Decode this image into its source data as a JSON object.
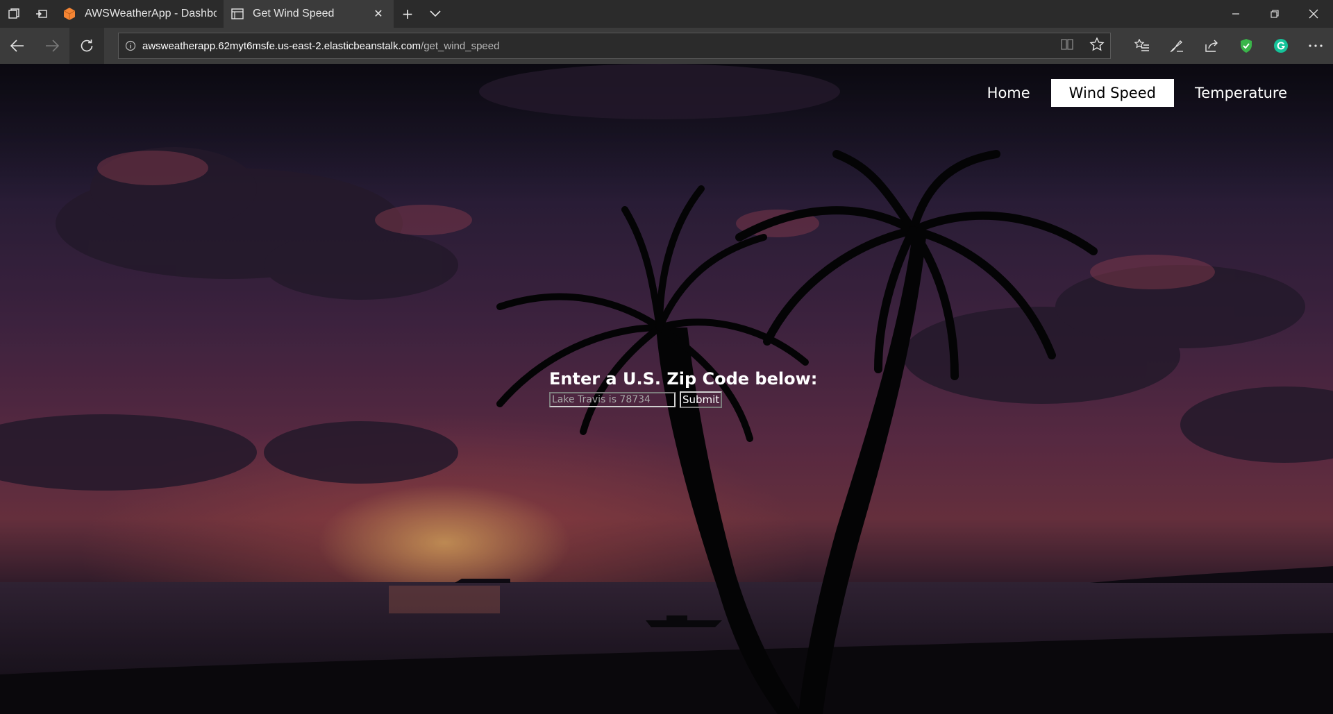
{
  "browser": {
    "tabs": [
      {
        "title": "AWSWeatherApp - Dashboa",
        "favicon": "aws-cube-icon",
        "active": false
      },
      {
        "title": "Get Wind Speed",
        "favicon": "page-icon",
        "active": true
      }
    ],
    "address": {
      "host": "awsweatherapp.62myt6msfe.us-east-2.elasticbeanstalk.com",
      "path": "/get_wind_speed"
    }
  },
  "nav": {
    "items": [
      {
        "label": "Home",
        "active": false
      },
      {
        "label": "Wind Speed",
        "active": true
      },
      {
        "label": "Temperature",
        "active": false
      }
    ]
  },
  "form": {
    "heading": "Enter a U.S. Zip Code below:",
    "input_placeholder": "Lake Travis is 78734",
    "input_value": "",
    "submit_label": "Submit"
  },
  "colors": {
    "chrome_dark": "#2b2b2b",
    "chrome_mid": "#3b3b3b",
    "nav_active_bg": "#ffffff",
    "grammarly_green": "#15c39a",
    "shield_green": "#3ab54a",
    "aws_orange": "#f58534"
  }
}
